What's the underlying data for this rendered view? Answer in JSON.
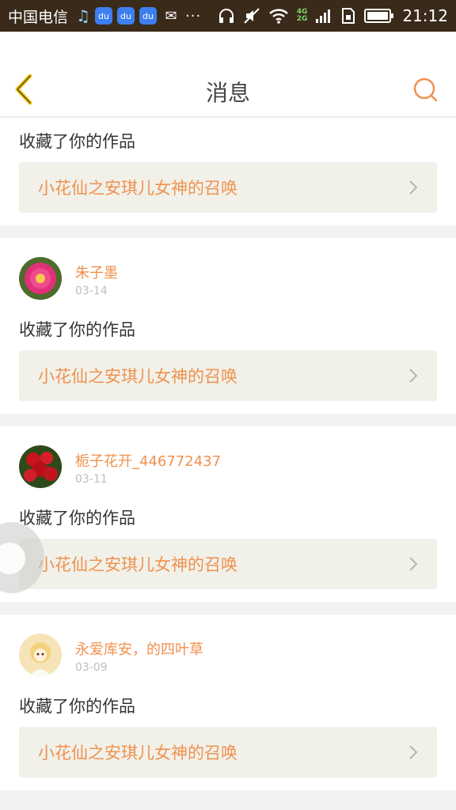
{
  "status_bar": {
    "carrier": "中国电信",
    "icons": [
      "headset-icon",
      "baidu-icon",
      "baidu-icon",
      "baidu-icon",
      "wechat-icon"
    ],
    "more": "···",
    "network_top": "4G",
    "network_bottom": "2G",
    "time": "21:12"
  },
  "header": {
    "title": "消息",
    "back_icon": "chevron-left-icon",
    "search_icon": "search-icon"
  },
  "colors": {
    "accent": "#f0914f",
    "back": "#f0c419",
    "work_bg": "#f1f1e9"
  },
  "messages": [
    {
      "user": "",
      "date": "",
      "action": "收藏了你的作品",
      "work_title": "小花仙之安琪儿女神的召唤"
    },
    {
      "user": "朱子墨",
      "date": "03-14",
      "action": "收藏了你的作品",
      "work_title": "小花仙之安琪儿女神的召唤"
    },
    {
      "user": "栀子花开_446772437",
      "date": "03-11",
      "action": "收藏了你的作品",
      "work_title": "小花仙之安琪儿女神的召唤"
    },
    {
      "user": "永爱库安，的四叶草",
      "date": "03-09",
      "action": "收藏了你的作品",
      "work_title": "小花仙之安琪儿女神的召唤"
    }
  ]
}
